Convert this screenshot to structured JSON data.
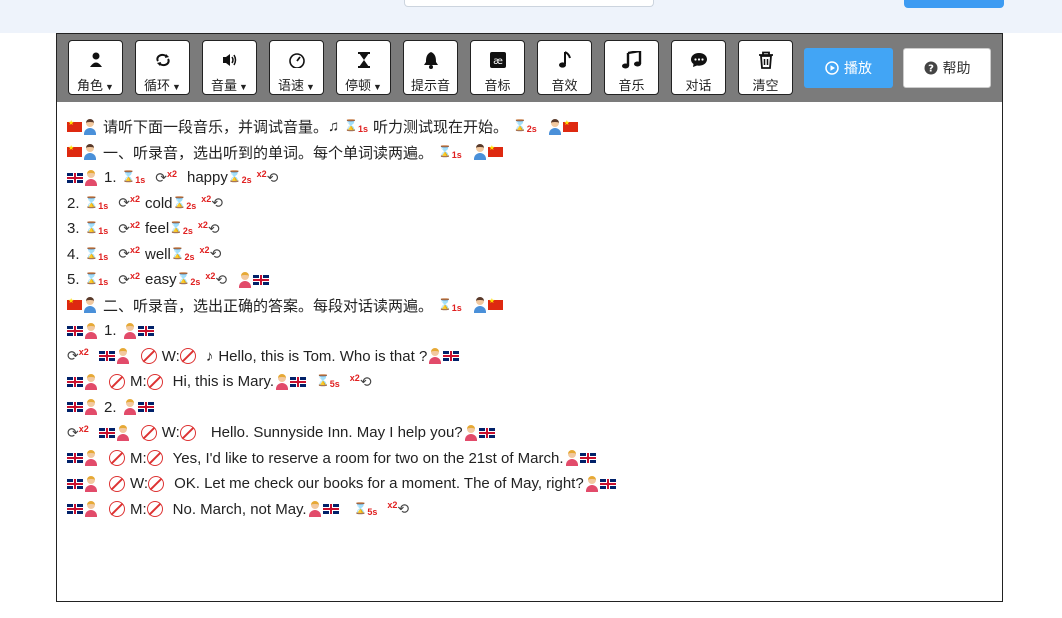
{
  "toolbar": {
    "role": "角色",
    "loop": "循环",
    "volume": "音量",
    "speed": "语速",
    "pause": "停顿",
    "prompt_tone": "提示音",
    "phonetic": "音标",
    "sound_effect": "音效",
    "music": "音乐",
    "dialog": "对话",
    "clear": "清空",
    "play": "播放",
    "help": "帮助"
  },
  "script": {
    "l1_a": "请听下面一段音乐，并调试音量。",
    "l1_b": "听力测试现在开始。",
    "l2": "一、听录音，选出听到的单词。每个单词读两遍。",
    "l3_num": "1.",
    "l3_word": "happy",
    "l4_num": "2.",
    "l4_word": "cold",
    "l5_num": "3.",
    "l5_word": "feel",
    "l6_num": "4.",
    "l6_word": "well",
    "l7_num": "5.",
    "l7_word": "easy",
    "l8": "二、听录音，选出正确的答案。每段对话读两遍。",
    "l9_num": "1.",
    "l10_spk": "W:",
    "l10_text": "Hello, this is Tom. Who is that ?",
    "l11_spk": "M:",
    "l11_text": "Hi, this is Mary.",
    "l12_num": "2.",
    "l13_spk": "W:",
    "l13_text": "Hello. Sunnyside Inn. May I help you?",
    "l14_spk": "M:",
    "l14_text": "Yes, I'd like to reserve a room for two on the 21st of March.",
    "l15_spk": "W:",
    "l15_text": "OK. Let me check our books for a moment. The of May, right?",
    "l16_spk": "M:",
    "l16_text": "No. March, not May."
  },
  "marks": {
    "p1s": "1s",
    "p2s": "2s",
    "p5s": "5s",
    "x2": "x2"
  },
  "icons": [
    "person-icon",
    "repeat-icon",
    "volume-icon",
    "speedometer-icon",
    "hourglass-icon",
    "bell-icon",
    "phonetic-icon",
    "music-note-icon",
    "music-icon",
    "chat-icon",
    "trash-icon",
    "play-circle-icon",
    "help-circle-icon"
  ],
  "colors": {
    "play": "#42a5f5",
    "toolbar": "#7b7b7b"
  }
}
